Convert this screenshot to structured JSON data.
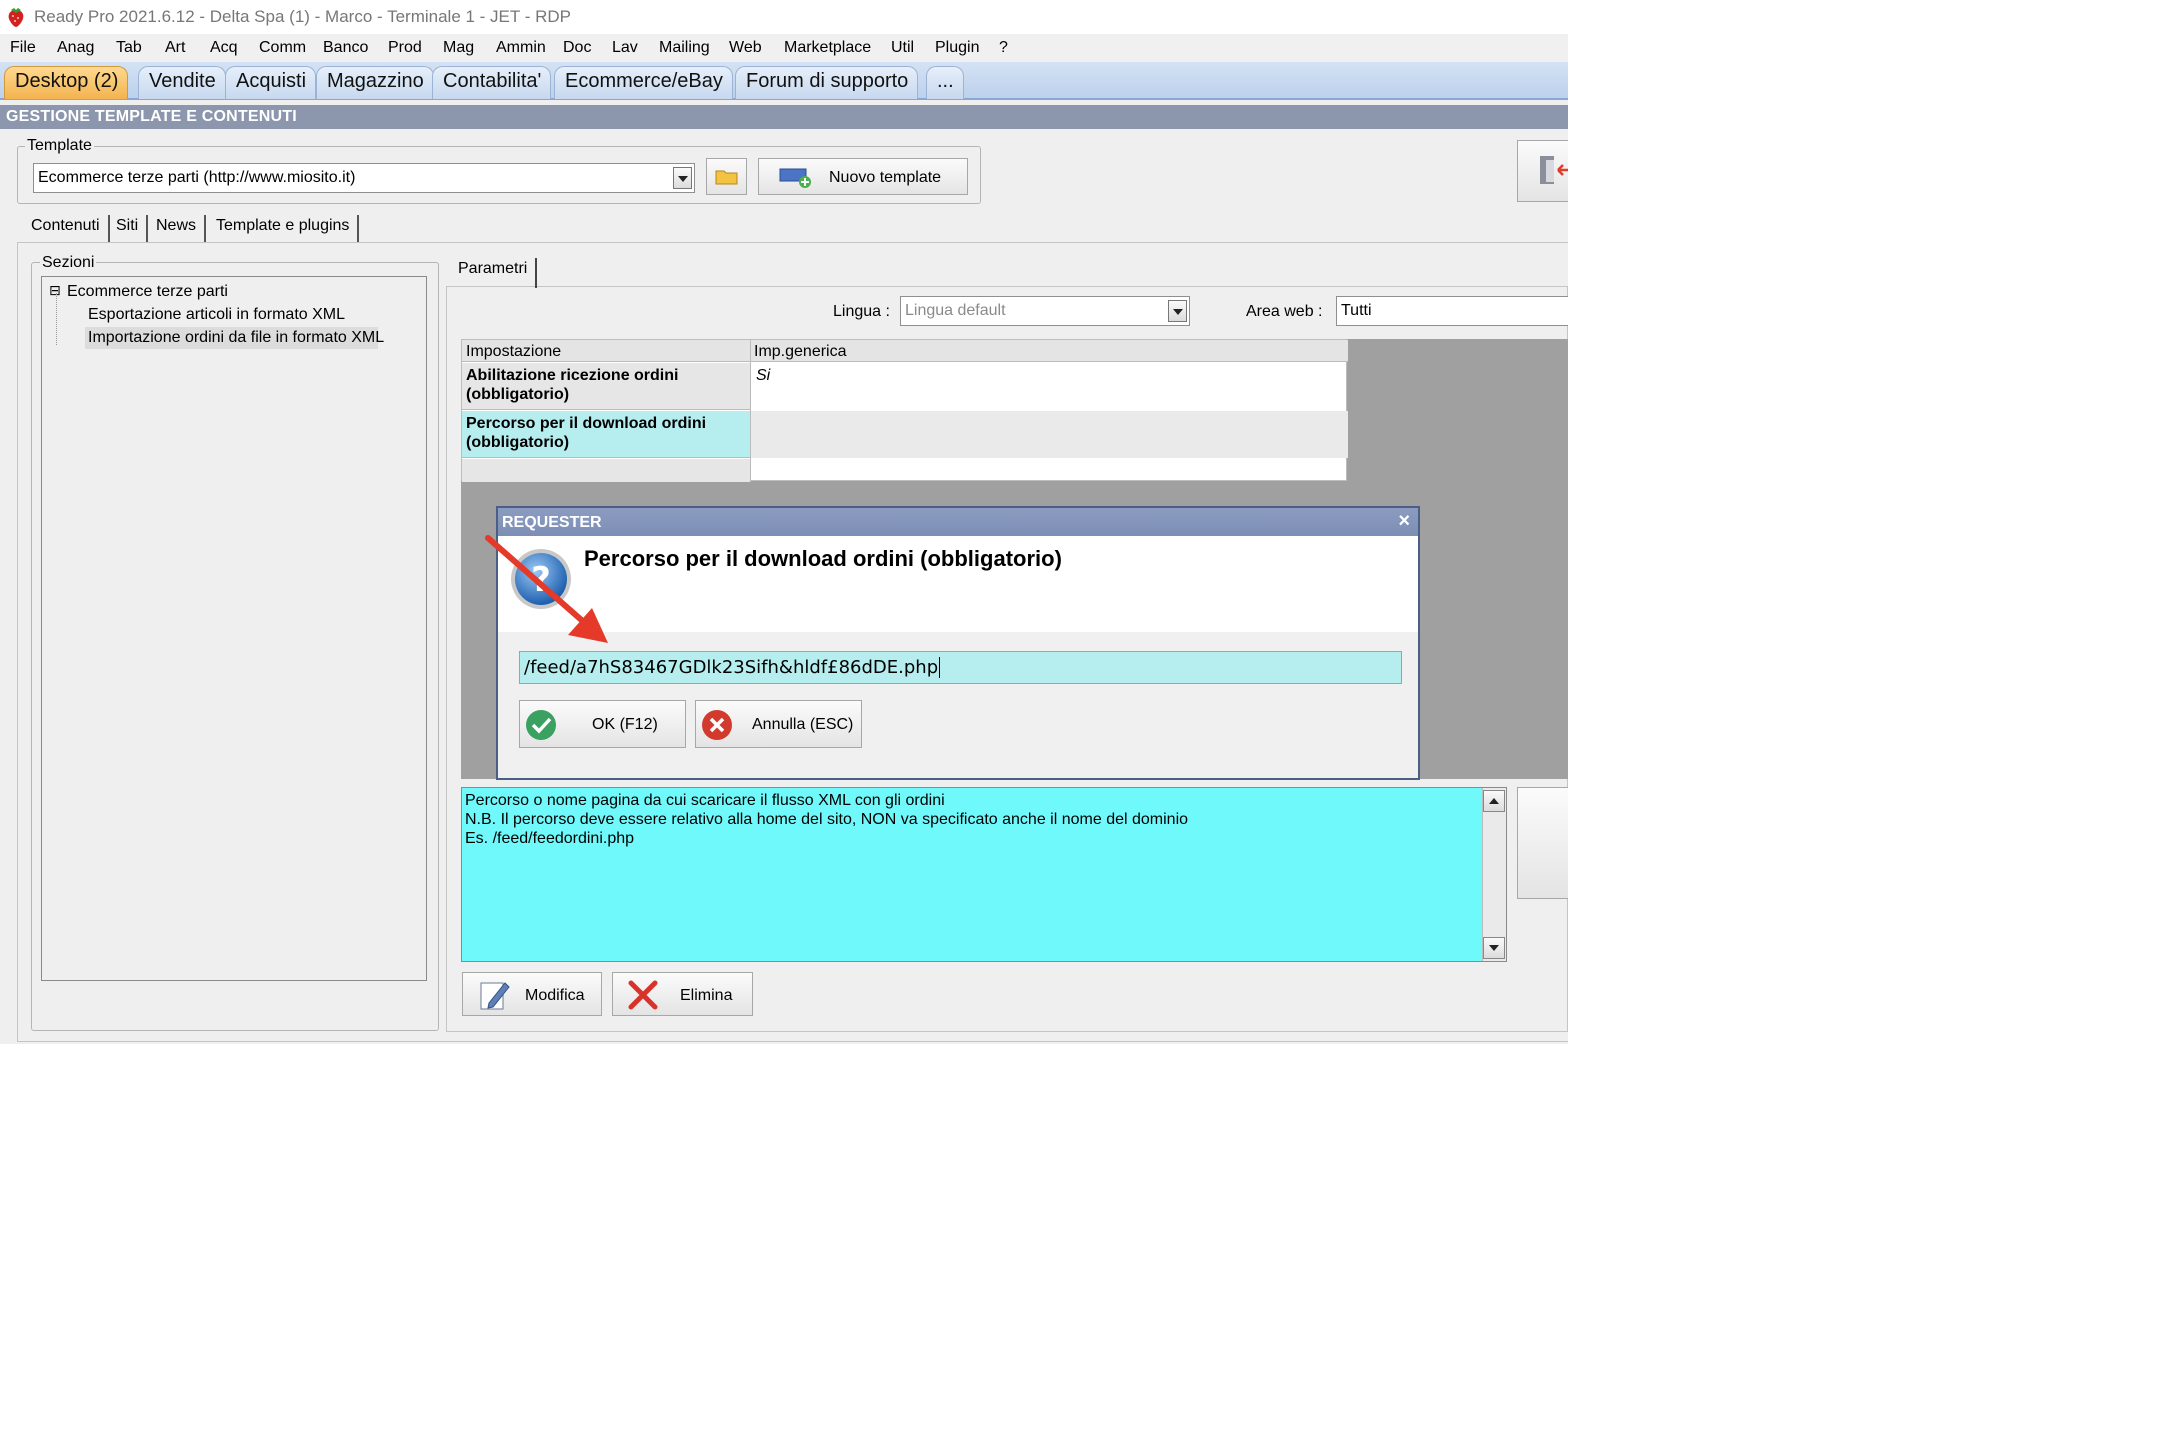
{
  "window": {
    "title": "Ready Pro 2021.6.12 - Delta Spa (1) - Marco - Terminale 1 - JET - RDP"
  },
  "menu": [
    "File",
    "Anag",
    "Tab",
    "Art",
    "Acq",
    "Comm",
    "Banco",
    "Prod",
    "Mag",
    "Ammin",
    "Doc",
    "Lav",
    "Mailing",
    "Web",
    "Marketplace",
    "Util",
    "Plugin",
    "?"
  ],
  "tabs": [
    "Desktop (2)",
    "Vendite",
    "Acquisti",
    "Magazzino",
    "Contabilita'",
    "Ecommerce/eBay",
    "Forum di supporto",
    "..."
  ],
  "section_title": "GESTIONE TEMPLATE E CONTENUTI",
  "template": {
    "legend": "Template",
    "selected": "Ecommerce terze parti (http://www.miosito.it)",
    "new_button": "Nuovo template"
  },
  "content_tabs": [
    "Contenuti",
    "Siti",
    "News",
    "Template e plugins"
  ],
  "sections": {
    "legend": "Sezioni",
    "root": "Ecommerce terze parti",
    "expander": "⊟",
    "items": [
      "Esportazione articoli in formato XML",
      "Importazione ordini da file in formato XML"
    ]
  },
  "params": {
    "tab": "Parametri",
    "lingua_label": "Lingua :",
    "lingua_value": "Lingua default",
    "area_label": "Area web :",
    "area_value": "Tutti",
    "columns": [
      "Impostazione",
      "Imp.generica"
    ],
    "rows": [
      {
        "name": "Abilitazione ricezione ordini (obbligatorio)",
        "value": "Si"
      },
      {
        "name": "Percorso per il download ordini (obbligatorio)",
        "value": ""
      }
    ]
  },
  "dialog": {
    "title": "REQUESTER",
    "close": "×",
    "question": "Percorso per il download ordini (obbligatorio)",
    "input_value": "/feed/a7hS83467GDlk23Sifh&hldf£86dDE.php",
    "ok": "OK (F12)",
    "cancel": "Annulla (ESC)"
  },
  "description": {
    "lines": [
      "Percorso o nome pagina da cui scaricare il flusso XML con gli ordini",
      "N.B. Il percorso deve essere relativo alla home del sito, NON va specificato anche il nome del dominio",
      "",
      "Es. /feed/feedordini.php"
    ]
  },
  "actions": {
    "edit": "Modifica",
    "delete": "Elimina"
  },
  "colors": {
    "accent_tab": "#f3b350",
    "highlight_row": "#b6eef0",
    "description_bg": "#6ff9fb",
    "annotation_arrow": "#e53a2a"
  }
}
